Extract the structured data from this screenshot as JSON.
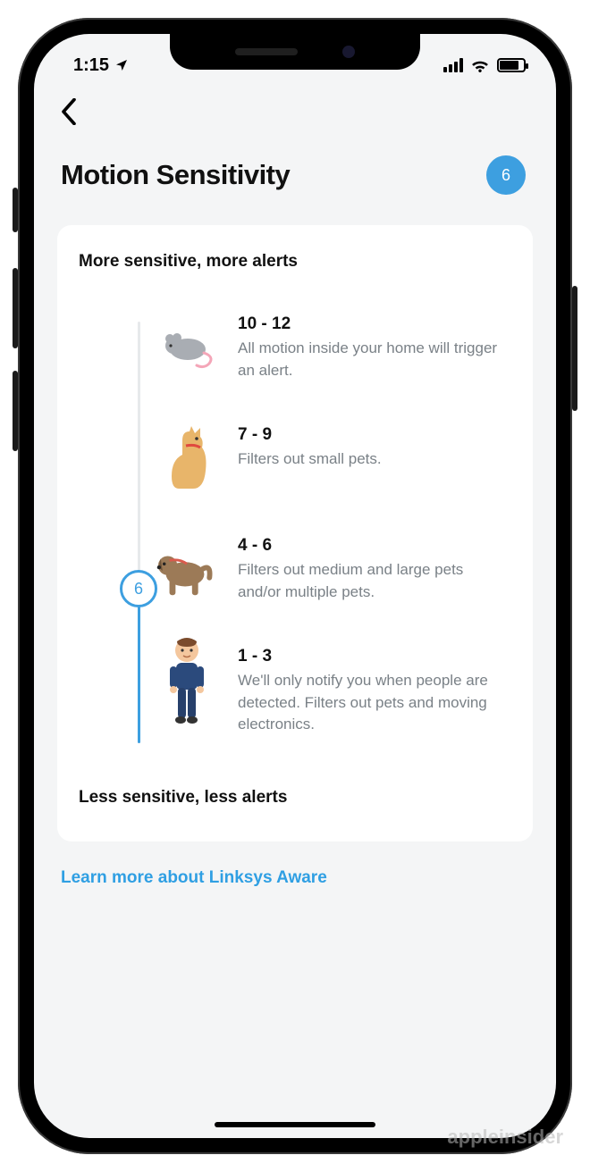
{
  "status_bar": {
    "time": "1:15",
    "location_icon": "▴"
  },
  "header": {
    "title": "Motion Sensitivity",
    "current_value": "6"
  },
  "card": {
    "top_label": "More sensitive, more alerts",
    "bottom_label": "Less sensitive, less alerts",
    "thumb_value": "6",
    "levels": [
      {
        "range": "10 - 12",
        "description": "All motion inside your home will trigger an alert."
      },
      {
        "range": "7 - 9",
        "description": "Filters out small pets."
      },
      {
        "range": "4 - 6",
        "description": "Filters out medium and large pets and/or multiple pets."
      },
      {
        "range": "1 - 3",
        "description": "We'll only notify you when people are detected. Filters out pets and moving electronics."
      }
    ]
  },
  "learn_more_label": "Learn more about Linksys Aware",
  "watermark": "appleinsider"
}
